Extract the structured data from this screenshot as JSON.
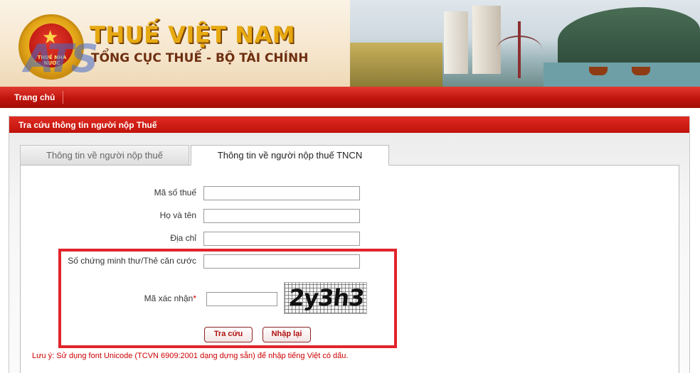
{
  "header": {
    "emblem_text": "THUẾ NHÀ NƯỚC",
    "watermark": "ATS",
    "title": "THUẾ VIỆT NAM",
    "subtitle": "TỔNG CỤC THUẾ - BỘ TÀI CHÍNH"
  },
  "nav": {
    "items": [
      {
        "label": "Trang chủ"
      }
    ]
  },
  "panel": {
    "title": "Tra cứu thông tin người nộp Thuế"
  },
  "tabs": [
    {
      "label": "Thông tin về người nộp thuế",
      "active": false
    },
    {
      "label": "Thông tin về người nộp thuế TNCN",
      "active": true
    }
  ],
  "form": {
    "tax_code": {
      "label": "Mã số thuế",
      "value": ""
    },
    "full_name": {
      "label": "Họ và tên",
      "value": ""
    },
    "address": {
      "label": "Địa chỉ",
      "value": ""
    },
    "id_number": {
      "label": "Số chứng minh thư/Thẻ căn cước",
      "value": ""
    },
    "captcha_input": {
      "label": "Mã xác nhận",
      "required_mark": "*",
      "value": ""
    },
    "captcha_image_text": "2y3h3",
    "search_button": "Tra cứu",
    "reset_button": "Nhập lại"
  },
  "note": "Lưu ý: Sử dụng font Unicode (TCVN 6909:2001 dạng dựng sẵn) để nhập tiếng Việt có dấu.",
  "colors": {
    "primary_red": "#c0140d",
    "highlight_box": "#e2242b",
    "title_gold": "#e7a911"
  }
}
